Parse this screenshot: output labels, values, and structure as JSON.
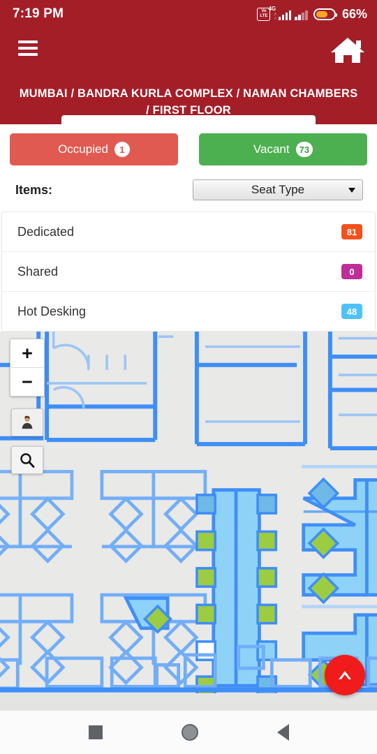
{
  "status_bar": {
    "clock": "7:19 PM",
    "volte_top": "Vo",
    "volte_bottom": "LTE",
    "network_label": "4G",
    "battery_percent": "66%",
    "battery_level": 66,
    "icons": [
      "volte-icon",
      "signal-4g-icon",
      "signal-icon",
      "battery-icon"
    ]
  },
  "header": {
    "menu_icon": "hamburger-menu-icon",
    "home_icon": "home-icon",
    "breadcrumb": "MUMBAI / BANDRA KURLA COMPLEX / NAMAN CHAMBERS / FIRST FLOOR",
    "background_color": "#a41e28"
  },
  "tabs": [
    {
      "label": "Occupied",
      "count": "1",
      "color": "#e05a52",
      "name": "tab-occupied"
    },
    {
      "label": "Vacant",
      "count": "73",
      "color": "#4caf50",
      "name": "tab-vacant"
    }
  ],
  "filter": {
    "label": "Items:",
    "selected": "Seat Type",
    "options": [
      "Seat Type"
    ],
    "caret_icon": "chevron-down-icon"
  },
  "seat_list": [
    {
      "label": "Dedicated",
      "count": "81",
      "color": "#f4511e"
    },
    {
      "label": "Shared",
      "count": "0",
      "color": "#bf2e98"
    },
    {
      "label": "Hot Desking",
      "count": "48",
      "color": "#4fc3f7"
    }
  ],
  "map": {
    "background_color": "#e9e9e7",
    "wall_color": "#3f8ef7",
    "desk_fill": "#8ed2f8",
    "seat_vacant_color": "#9ccc41",
    "controls": {
      "zoom_in": "+",
      "zoom_out": "−",
      "pegman_icon": "pegman-person-icon",
      "search_icon": "search-icon",
      "fab_icon": "chevron-up-icon"
    }
  },
  "nav_bar": {
    "recents": "recents-square-icon",
    "home": "home-circle-icon",
    "back": "back-triangle-icon"
  }
}
